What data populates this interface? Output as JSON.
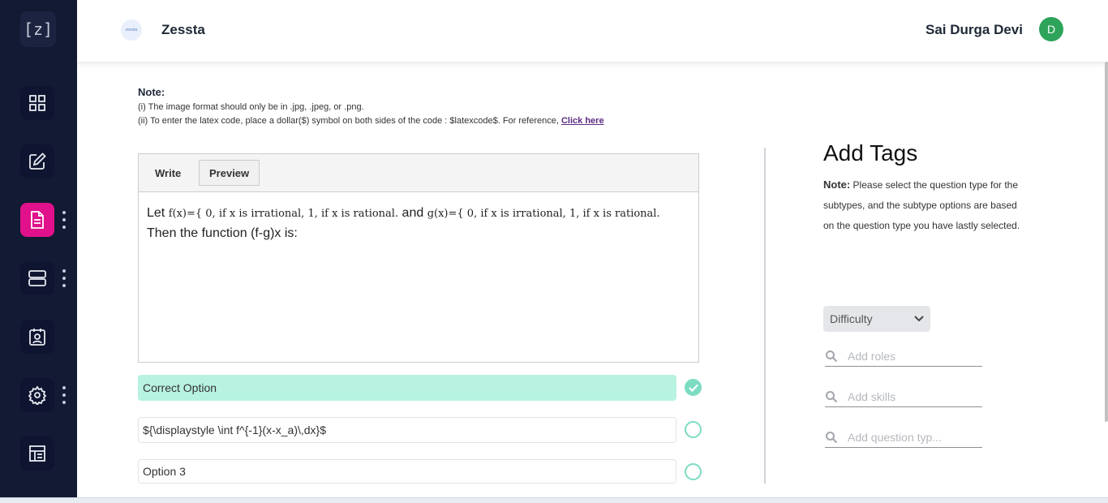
{
  "sidebar": {
    "logo_text": "[z]",
    "items": [
      {
        "icon": "grid-icon"
      },
      {
        "icon": "edit-icon"
      },
      {
        "icon": "document-icon",
        "active": true
      },
      {
        "icon": "server-icon"
      },
      {
        "icon": "calendar-user-icon"
      },
      {
        "icon": "gear-icon"
      },
      {
        "icon": "building-icon"
      }
    ],
    "active_color": "#e0118a"
  },
  "header": {
    "brand_logo_text": "zessta",
    "brand_name": "Zessta",
    "user_name": "Sai Durga Devi",
    "avatar_initial": "D",
    "avatar_color": "#2ea35a"
  },
  "notes": {
    "title": "Note:",
    "line1": "(i) The image format should only be in .jpg, .jpeg, or .png.",
    "line2": "(ii) To enter the latex code, place a dollar($) symbol on both sides of the code : $latexcode$. For reference, ",
    "link": "Click here"
  },
  "editor": {
    "tab_write": "Write",
    "tab_preview": "Preview",
    "preview": {
      "t1": "Let",
      "m1": "f(x)={ 0,    if x is irrational, 1,    if x is rational.",
      "t2": "and",
      "m2": "g(x)={ 0,    if x is irrational, 1,    if x is rational.",
      "t3": "Then the function (f-g)x is:"
    }
  },
  "options": [
    {
      "text": "Correct Option",
      "correct": true
    },
    {
      "text": "${\\displaystyle \\int f^{-1}(x-x_a)\\,dx}$",
      "correct": false
    },
    {
      "text": "Option 3",
      "correct": false
    }
  ],
  "tags": {
    "title": "Add Tags",
    "note_label": "Note:",
    "note_text": " Please select the question type for the subtypes, and the subtype options are based on the question type you have lastly selected.",
    "difficulty_value": "Difficulty",
    "roles_placeholder": "Add roles",
    "skills_placeholder": "Add skills",
    "qtype_placeholder": "Add question typ..."
  },
  "colors": {
    "sidebar_bg": "#131a33",
    "correct_bg": "#b8f2e1",
    "radio": "#7bdcc2"
  }
}
